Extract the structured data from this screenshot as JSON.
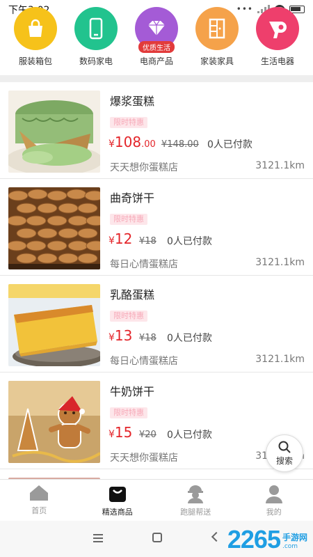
{
  "status_bar": {
    "time": "下午3:02",
    "dots": "•••"
  },
  "categories": [
    {
      "label": "服装箱包",
      "icon": "shopping-bag-icon",
      "color": "#f6c21a"
    },
    {
      "label": "数码家电",
      "icon": "phone-icon",
      "color": "#22c38e"
    },
    {
      "label": "电商产品",
      "icon": "diamond-icon",
      "color": "#a45bd6",
      "badge": "优质生活"
    },
    {
      "label": "家装家具",
      "icon": "cabinet-icon",
      "color": "#f5a24a"
    },
    {
      "label": "生活电器",
      "icon": "hair-dryer-icon",
      "color": "#ee3f6c"
    }
  ],
  "products": [
    {
      "title": "爆浆蛋糕",
      "promo": "限时特惠",
      "currency": "¥",
      "price_int": "108",
      "price_dec": ".00",
      "old_price": "¥148.00",
      "paid": "0人已付款",
      "shop": "天天想你蛋糕店",
      "distance": "3121.1km"
    },
    {
      "title": "曲奇饼干",
      "promo": "限时特惠",
      "currency": "¥",
      "price_int": "12",
      "price_dec": "",
      "old_price": "¥18",
      "paid": "0人已付款",
      "shop": "每日心情蛋糕店",
      "distance": "3121.1km"
    },
    {
      "title": "乳酪蛋糕",
      "promo": "限时特惠",
      "currency": "¥",
      "price_int": "13",
      "price_dec": "",
      "old_price": "¥18",
      "paid": "0人已付款",
      "shop": "每日心情蛋糕店",
      "distance": "3121.1km"
    },
    {
      "title": "牛奶饼干",
      "promo": "限时特惠",
      "currency": "¥",
      "price_int": "15",
      "price_dec": "",
      "old_price": "¥20",
      "paid": "0人已付款",
      "shop": "天天想你蛋糕店",
      "distance": "3121.1km"
    }
  ],
  "float_search": {
    "label": "搜索",
    "icon": "search-icon"
  },
  "tabs": [
    {
      "label": "首页",
      "icon": "home-icon",
      "active": false
    },
    {
      "label": "精选商品",
      "icon": "shopping-bag-icon",
      "active": true
    },
    {
      "label": "跑腿帮送",
      "icon": "courier-icon",
      "active": false
    },
    {
      "label": "我的",
      "icon": "user-icon",
      "active": false
    }
  ],
  "watermark": {
    "number": "2265",
    "suffix": ".com",
    "cn": "手游网"
  },
  "colors": {
    "price": "#e4252a",
    "promo_bg": "#fde6ea",
    "promo_text": "#f7a9b8",
    "watermark": "#1f9ee3"
  }
}
